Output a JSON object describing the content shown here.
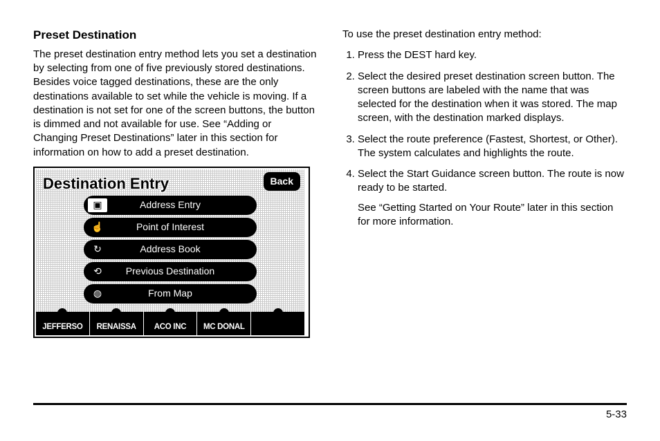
{
  "heading": "Preset Destination",
  "intro": "The preset destination entry method lets you set a destination by selecting from one of five previously stored destinations. Besides voice tagged destinations, these are the only destinations available to set while the vehicle is moving. If a destination is not set for one of the screen buttons, the button is dimmed and not available for use. See “Adding or Changing Preset Destinations” later in this section for information on how to add a preset destination.",
  "right_intro": "To use the preset destination entry method:",
  "steps": [
    "Press the DEST hard key.",
    "Select the desired preset destination screen button. The screen buttons are labeled with the name that was selected for the destination when it was stored. The map screen, with the destination marked displays.",
    "Select the route preference (Fastest, Shortest, or Other). The system calculates and highlights the route.",
    "Select the Start Guidance screen button. The route is now ready to be started."
  ],
  "afternote": "See “Getting Started on Your Route” later in this section for more information.",
  "screen": {
    "title": "Destination Entry",
    "back": "Back",
    "items": [
      {
        "label": "Address Entry",
        "icon": "▣"
      },
      {
        "label": "Point of Interest",
        "icon": "☝"
      },
      {
        "label": "Address Book",
        "icon": "↻"
      },
      {
        "label": "Previous Destination",
        "icon": "⟲"
      },
      {
        "label": "From Map",
        "icon": "◍"
      }
    ],
    "presets": [
      "JEFFERSO",
      "RENAISSA",
      "ACO INC",
      "MC DONAL",
      ""
    ]
  },
  "page_number": "5-33"
}
